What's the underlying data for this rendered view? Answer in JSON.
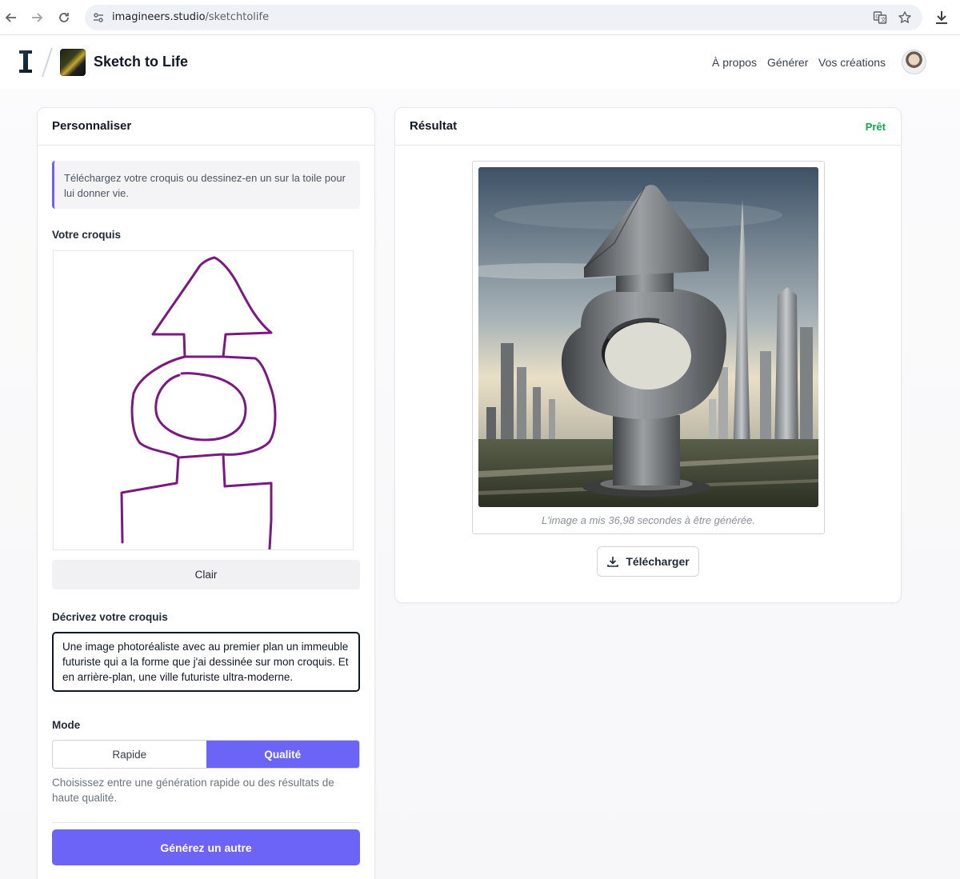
{
  "browser": {
    "url_host": "imagineers.studio",
    "url_path": "/sketchtolife",
    "icons": [
      "back-arrow-icon",
      "forward-arrow-icon",
      "reload-icon",
      "site-settings-icon",
      "translate-icon",
      "bookmark-star-icon",
      "download-icon"
    ]
  },
  "header": {
    "app_title": "Sketch to Life",
    "nav": [
      "À propos",
      "Générer",
      "Vos créations"
    ]
  },
  "left_panel": {
    "title": "Personnaliser",
    "info": "Téléchargez votre croquis ou dessinez-en un sur la toile pour lui donner vie.",
    "sketch_label": "Votre croquis",
    "sketch_stroke_color": "#7a1a80",
    "clear_button": "Clair",
    "description_label": "Décrivez votre croquis",
    "description_value": "Une image photoréaliste avec au premier plan un immeuble futuriste qui a la forme que j'ai dessinée sur mon croquis. Et en arrière-plan, une ville futuriste ultra-moderne.",
    "mode_label": "Mode",
    "mode_options": [
      "Rapide",
      "Qualité"
    ],
    "mode_selected": "Qualité",
    "mode_help": "Choisissez entre une génération rapide ou des résultats de haute qualité.",
    "generate_button": "Générez un autre"
  },
  "right_panel": {
    "title": "Résultat",
    "status": "Prêt",
    "caption": "L'image a mis 36,98 secondes à être générée.",
    "download_button": "Télécharger"
  },
  "colors": {
    "accent": "#6c63f7",
    "status_ok": "#16a34a"
  }
}
